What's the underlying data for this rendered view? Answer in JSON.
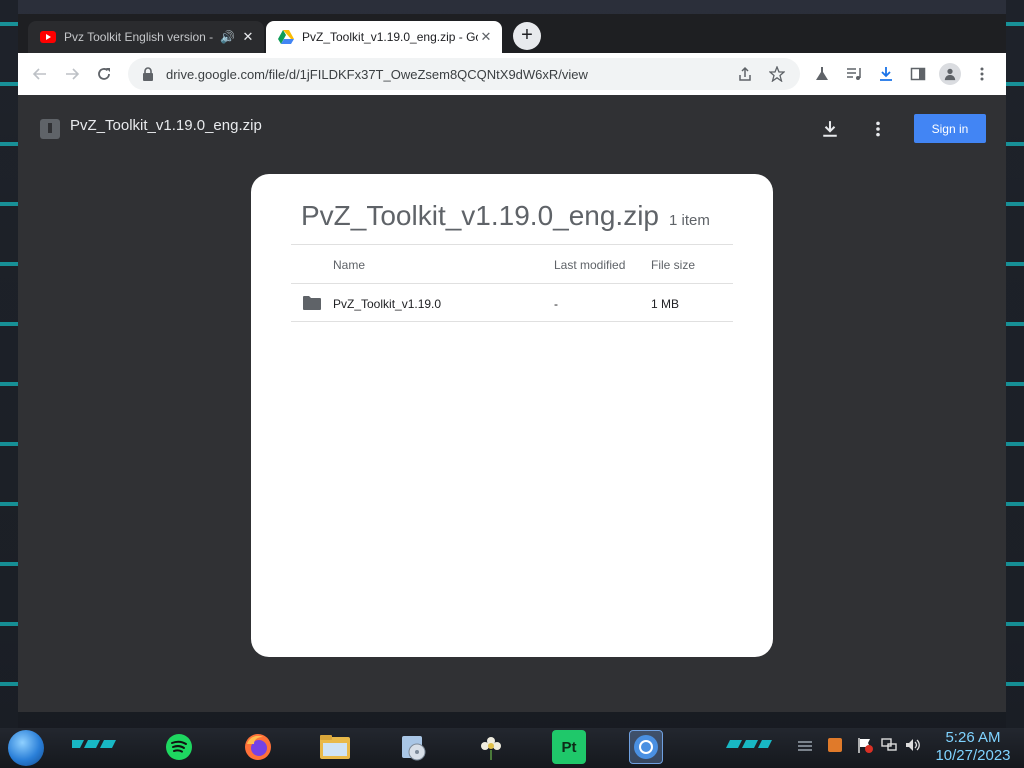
{
  "browser": {
    "tabs": [
      {
        "title": "Pvz Toolkit English version -",
        "favicon": "youtube-icon",
        "audio": true,
        "active": false
      },
      {
        "title": "PvZ_Toolkit_v1.19.0_eng.zip - Go",
        "favicon": "google-drive-icon",
        "active": true
      }
    ],
    "new_tab_label": "+",
    "url": "drive.google.com/file/d/1jFILDKFx37T_OweZsem8QCQNtX9dW6xR/view"
  },
  "drive": {
    "file_title": "PvZ_Toolkit_v1.19.0_eng.zip",
    "sign_in_label": "Sign in",
    "accent_color": "#4285f4"
  },
  "archive": {
    "title": "PvZ_Toolkit_v1.19.0_eng.zip",
    "item_count": "1 item",
    "columns": [
      "Name",
      "Last modified",
      "File size"
    ],
    "rows": [
      {
        "name": "PvZ_Toolkit_v1.19.0",
        "modified": "-",
        "size": "1 MB",
        "icon": "folder-icon"
      }
    ]
  },
  "taskbar": {
    "apps": [
      "spotify-icon",
      "firefox-icon",
      "file-explorer-icon",
      "installer-icon",
      "flower-app-icon",
      "pt-app-icon",
      "chrome-icon"
    ],
    "pt_label": "Pt",
    "clock_time": "5:26 AM",
    "clock_date": "10/27/2023"
  }
}
